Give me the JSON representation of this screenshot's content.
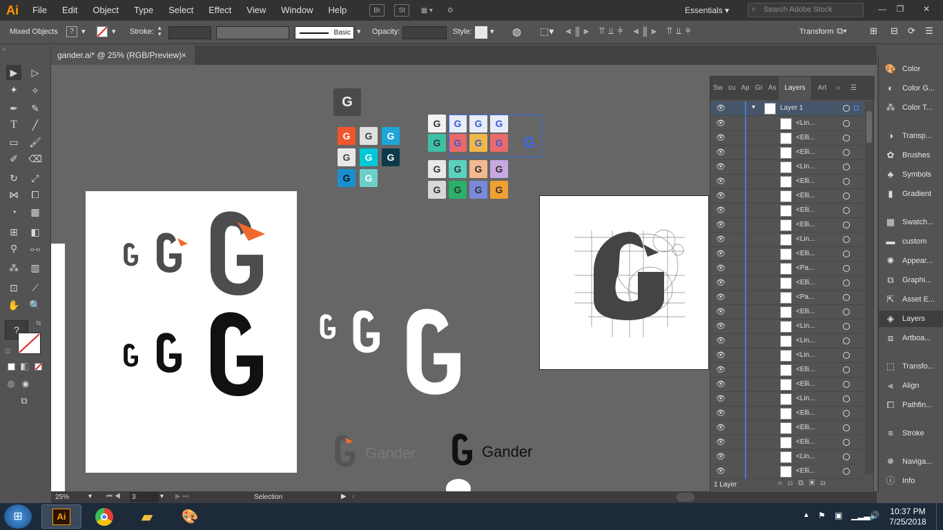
{
  "app": {
    "logo": "Ai"
  },
  "menu": [
    "File",
    "Edit",
    "Object",
    "Type",
    "Select",
    "Effect",
    "View",
    "Window",
    "Help"
  ],
  "menubar_icons": [
    "Br",
    "St"
  ],
  "workspace": "Essentials",
  "search": {
    "placeholder": "Search Adobe Stock"
  },
  "control": {
    "selection_type": "Mixed Objects",
    "stroke_label": "Stroke:",
    "stroke_style": "Basic",
    "opacity_label": "Opacity:",
    "style_label": "Style:",
    "transform_label": "Transform"
  },
  "document": {
    "tab_title": "gander.ai* @ 25% (RGB/Preview)",
    "close": "×"
  },
  "tools": {
    "fill_unknown": "?"
  },
  "status": {
    "zoom": "25%",
    "artboard": "3",
    "mode": "Selection"
  },
  "layers_panel": {
    "tabs": [
      "Sw",
      "cu",
      "Ap",
      "Gr",
      "As",
      "Layers",
      "Art"
    ],
    "layer_name": "Layer 1",
    "rows": [
      "<Lin...",
      "<Elli...",
      "<Elli...",
      "<Lin...",
      "<Elli...",
      "<Elli...",
      "<Elli...",
      "<Elli...",
      "<Lin...",
      "<Elli...",
      "<Pa...",
      "<Elli...",
      "<Pa...",
      "<Elli...",
      "<Lin...",
      "<Lin...",
      "<Lin...",
      "<Elli...",
      "<Elli...",
      "<Lin...",
      "<Elli...",
      "<Elli...",
      "<Elli...",
      "<Lin...",
      "<Elli..."
    ],
    "footer": "1 Layer"
  },
  "dock": [
    "Color",
    "Color G...",
    "Color T...",
    "Transp...",
    "Brushes",
    "Symbols",
    "Gradient",
    "Swatch...",
    "custom",
    "Appear...",
    "Graphi...",
    "Asset E...",
    "Layers",
    "Artboa...",
    "Transfo...",
    "Align",
    "Pathfin...",
    "Stroke",
    "Naviga...",
    "Info"
  ],
  "canvas": {
    "brand_text_gray": "Gander",
    "brand_text_black": "Gander",
    "logo_letter": "G",
    "question": "?"
  },
  "taskbar": {
    "time": "10:37 PM",
    "date": "7/25/2018"
  }
}
